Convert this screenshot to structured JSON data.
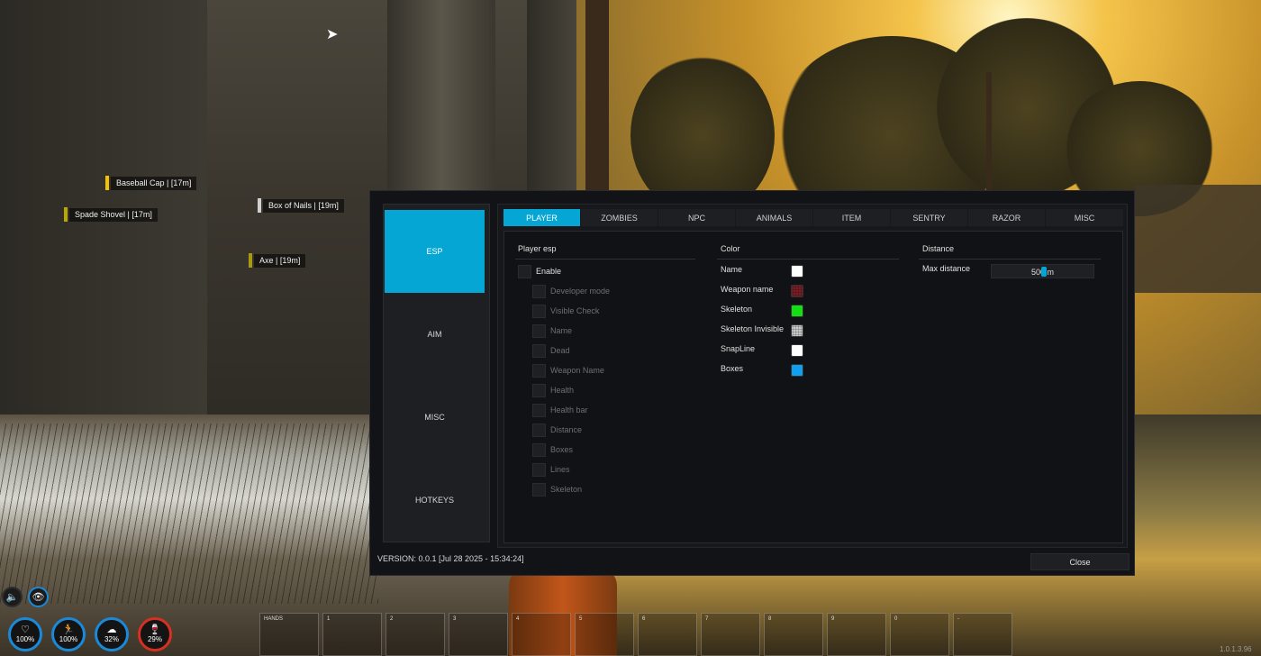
{
  "esp_labels": [
    {
      "text": "Baseball Cap | [17m]",
      "color": "#f2c200"
    },
    {
      "text": "Spade Shovel  | [17m]",
      "color": "#b9a800"
    },
    {
      "text": "Box of Nails | [19m]",
      "color": "#d0d0d0"
    },
    {
      "text": "Axe | [19m]",
      "color": "#a89a10"
    }
  ],
  "sidebar": {
    "items": [
      {
        "label": "ESP",
        "active": true
      },
      {
        "label": "AIM",
        "active": false
      },
      {
        "label": "MISC",
        "active": false
      },
      {
        "label": "HOTKEYS",
        "active": false
      }
    ]
  },
  "tabs": [
    {
      "label": "PLAYER",
      "active": true
    },
    {
      "label": "ZOMBIES",
      "active": false
    },
    {
      "label": "NPC",
      "active": false
    },
    {
      "label": "ANIMALS",
      "active": false
    },
    {
      "label": "ITEM",
      "active": false
    },
    {
      "label": "SENTRY",
      "active": false
    },
    {
      "label": "RAZOR",
      "active": false
    },
    {
      "label": "MISC",
      "active": false
    }
  ],
  "player_esp": {
    "title": "Player esp",
    "enable_label": "Enable",
    "options": [
      "Developer mode",
      "Visible Check",
      "Name",
      "Dead",
      "Weapon Name",
      "Health",
      "Health bar",
      "Distance",
      "Boxes",
      "Lines",
      "Skeleton"
    ]
  },
  "color": {
    "title": "Color",
    "items": [
      {
        "label": "Name",
        "color": "#ffffff",
        "pattern": false
      },
      {
        "label": "Weapon name",
        "color": "#7a1e24",
        "pattern": true
      },
      {
        "label": "Skeleton",
        "color": "#12e012",
        "pattern": false
      },
      {
        "label": "Skeleton Invisible",
        "color": "#c8c8c8",
        "pattern": true
      },
      {
        "label": "SnapLine",
        "color": "#ffffff",
        "pattern": false
      },
      {
        "label": "Boxes",
        "color": "#0fa0f0",
        "pattern": false
      }
    ]
  },
  "distance": {
    "title": "Distance",
    "max_label": "Max distance",
    "value": "500 m",
    "accent": "#06a6d4"
  },
  "footer": {
    "version": "VERSION: 0.0.1 [Jul 28 2025 - 15:34:24]",
    "close_label": "Close"
  },
  "hud": {
    "stats": [
      {
        "icon": "heart-icon",
        "glyph": "♡",
        "value": "100%",
        "ring": "#1a8ad8"
      },
      {
        "icon": "stamina-icon",
        "glyph": "🏃",
        "value": "100%",
        "ring": "#1a8ad8"
      },
      {
        "icon": "food-icon",
        "glyph": "☁",
        "value": "32%",
        "ring": "#1a8ad8"
      },
      {
        "icon": "water-icon",
        "glyph": "🍷",
        "value": "29%",
        "ring": "#d83020"
      }
    ],
    "slots": [
      "HANDS",
      "1",
      "2",
      "3",
      "4",
      "5",
      "6",
      "7",
      "8",
      "9",
      "0",
      "-"
    ],
    "build": "1.0.1.3.96"
  }
}
